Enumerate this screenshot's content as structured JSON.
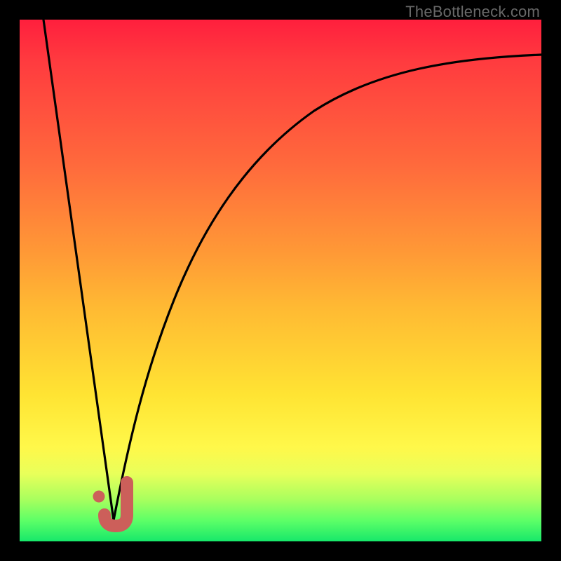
{
  "watermark": "TheBottleneck.com",
  "colors": {
    "frame": "#000000",
    "gradient_top": "#ff1f3d",
    "gradient_bottom": "#17e86a",
    "curve": "#000000",
    "marker_fill": "#cc5f5a",
    "marker_stroke": "#cc5f5a"
  },
  "chart_data": {
    "type": "line",
    "title": "",
    "xlabel": "",
    "ylabel": "",
    "xlim": [
      0,
      100
    ],
    "ylim": [
      0,
      100
    ],
    "grid": false,
    "legend": false,
    "series": [
      {
        "name": "left-descent",
        "x": [
          4.5,
          18
        ],
        "y": [
          100,
          4
        ]
      },
      {
        "name": "right-curve",
        "x": [
          18,
          20,
          22,
          24,
          26,
          28,
          30,
          33,
          36,
          40,
          45,
          50,
          56,
          62,
          70,
          78,
          86,
          94,
          100
        ],
        "y": [
          4,
          14,
          24,
          33,
          40,
          47,
          52,
          58,
          63,
          68,
          73,
          77,
          80.5,
          83,
          85.5,
          87.5,
          89,
          90,
          91
        ]
      }
    ],
    "markers": [
      {
        "name": "j-hook",
        "x": 18,
        "y": 5
      },
      {
        "name": "dot-left",
        "x": 15.5,
        "y": 9
      }
    ]
  }
}
